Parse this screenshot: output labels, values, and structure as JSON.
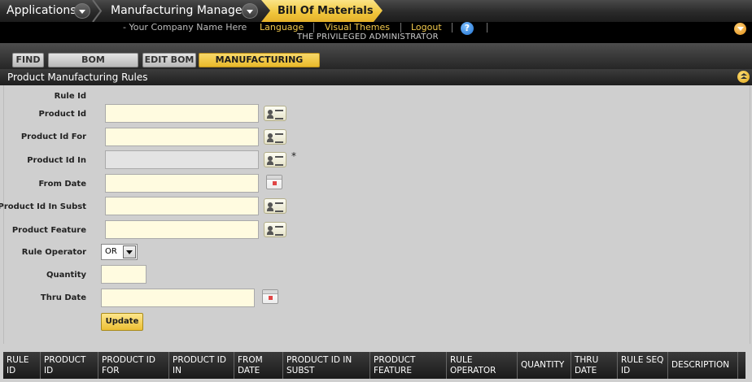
{
  "nav": {
    "applications": "Applications",
    "manufacturing_manager": "Manufacturing Manager",
    "current": "Bill Of Materials"
  },
  "header": {
    "company": "- Your Company Name Here",
    "language": "Language",
    "visual_themes": "Visual Themes",
    "logout": "Logout",
    "help": "?",
    "user": "THE PRIVILEGED ADMINISTRATOR"
  },
  "tabs": [
    "FIND",
    "BOM SIMULATION",
    "EDIT BOM",
    "MANUFACTURING RULES"
  ],
  "screenlet": {
    "title": "Product Manufacturing Rules"
  },
  "form": {
    "rule_id": "Rule Id",
    "product_id": "Product Id",
    "product_id_for": "Product Id For",
    "product_id_in": "Product Id In",
    "required_mark": "*",
    "from_date": "From Date",
    "product_id_in_subst": "Product Id In Subst",
    "product_feature": "Product Feature",
    "rule_operator": "Rule Operator",
    "rule_operator_value": "OR",
    "quantity": "Quantity",
    "thru_date": "Thru Date",
    "update": "Update"
  },
  "table": {
    "columns": [
      "RULE ID",
      "PRODUCT ID",
      "PRODUCT ID FOR",
      "PRODUCT ID IN",
      "FROM DATE",
      "PRODUCT ID IN SUBST",
      "PRODUCT FEATURE",
      "RULE OPERATOR",
      "QUANTITY",
      "THRU DATE",
      "RULE SEQ ID",
      "DESCRIPTION"
    ]
  },
  "colors": {
    "accent": "#f0c53b",
    "bar": "#1e1e1e",
    "form_bg": "#cfcfcf",
    "input_bg": "#fffbe0"
  }
}
